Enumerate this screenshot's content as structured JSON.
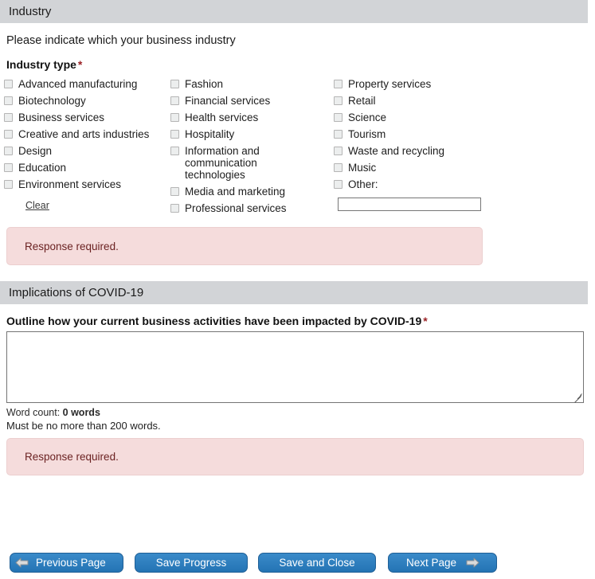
{
  "industry_section": {
    "header": "Industry",
    "prompt": "Please indicate which your business industry",
    "field_label": "Industry type",
    "required_marker": "*",
    "columns": [
      {
        "items": [
          {
            "label": "Advanced manufacturing",
            "checked": false
          },
          {
            "label": "Biotechnology",
            "checked": false
          },
          {
            "label": "Business services",
            "checked": false
          },
          {
            "label": "Creative and arts industries",
            "checked": false
          },
          {
            "label": "Design",
            "checked": false
          },
          {
            "label": "Education",
            "checked": false
          },
          {
            "label": "Environment services",
            "checked": false
          }
        ]
      },
      {
        "items": [
          {
            "label": "Fashion",
            "checked": false
          },
          {
            "label": "Financial services",
            "checked": false
          },
          {
            "label": "Health services",
            "checked": false
          },
          {
            "label": "Hospitality",
            "checked": false
          },
          {
            "label": "Information and communication technologies",
            "checked": false
          },
          {
            "label": "Media and marketing",
            "checked": false
          },
          {
            "label": "Professional services",
            "checked": false
          }
        ]
      },
      {
        "items": [
          {
            "label": "Property services",
            "checked": false
          },
          {
            "label": "Retail",
            "checked": false
          },
          {
            "label": "Science",
            "checked": false
          },
          {
            "label": "Tourism",
            "checked": false
          },
          {
            "label": "Waste and recycling",
            "checked": false
          },
          {
            "label": "Music",
            "checked": false
          },
          {
            "label": "Other:",
            "checked": false
          }
        ]
      }
    ],
    "other_input": {
      "value": "",
      "placeholder": ""
    },
    "clear_link": "Clear",
    "error": "Response required."
  },
  "covid_section": {
    "header": "Implications of COVID-19",
    "question": "Outline how your current business activities have been impacted by COVID-19",
    "required_marker": "*",
    "textarea": {
      "value": "",
      "placeholder": ""
    },
    "word_count_label": "Word count:",
    "word_count_value": "0 words",
    "limit_note": "Must be no more than 200 words.",
    "error": "Response required."
  },
  "buttons": {
    "previous": "Previous Page",
    "save_progress": "Save Progress",
    "save_and_close": "Save and Close",
    "next": "Next Page"
  },
  "colors": {
    "section_bar": "#d2d4d7",
    "error_bg": "#f5dcdc",
    "error_text": "#6b2222",
    "button_blue": "#2b7dbe",
    "required_star": "#9b2226"
  }
}
